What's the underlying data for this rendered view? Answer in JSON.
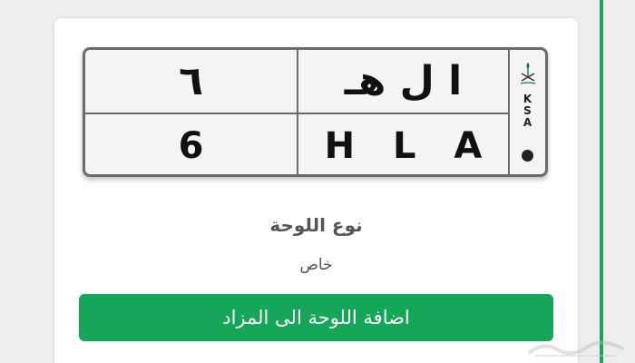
{
  "plate": {
    "arabic_number": "٦",
    "arabic_letters": "ا ل هـ",
    "english_number": "6",
    "english_letters": "H L A",
    "country_code": "KSA",
    "country_letters": [
      "K",
      "S",
      "A"
    ]
  },
  "details": {
    "plate_type_label": "نوع اللوحة",
    "plate_type_value": "خاص"
  },
  "actions": {
    "add_to_auction_label": "اضافة اللوحة الى المزاد"
  },
  "colors": {
    "accent_green": "#16a659",
    "side_line_green": "#20a35a",
    "plate_border": "#6b6b6b"
  },
  "icons": {
    "emblem": "saudi-emblem-icon",
    "watermark": "haraj-watermark-icon"
  }
}
